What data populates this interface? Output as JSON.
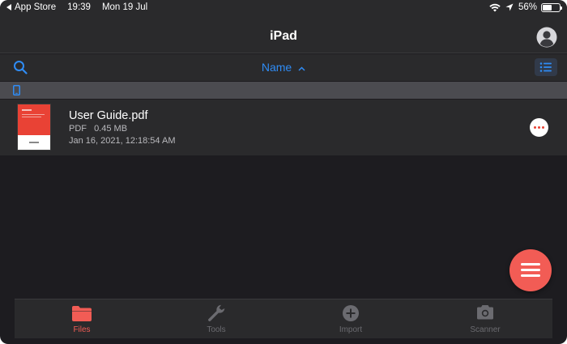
{
  "status_bar": {
    "back_app": "App Store",
    "time": "19:39",
    "date": "Mon 19 Jul",
    "battery": "56%",
    "battery_level": 0.56
  },
  "nav": {
    "title": "iPad",
    "account_icon": "person-circle-icon"
  },
  "toolbar": {
    "search_icon": "search-icon",
    "sort_label": "Name",
    "sort_caret": "^",
    "view_icon": "list-view-icon"
  },
  "section": {
    "icon": "ipad-device-icon"
  },
  "files": [
    {
      "name": "User Guide.pdf",
      "type": "PDF",
      "size": "0.45 MB",
      "date": "Jan 16, 2021, 12:18:54 AM"
    }
  ],
  "tabs": [
    {
      "label": "Files",
      "icon": "folder-icon",
      "active": true
    },
    {
      "label": "Tools",
      "icon": "wrench-icon",
      "active": false
    },
    {
      "label": "Import",
      "icon": "plus-circle-icon",
      "active": false
    },
    {
      "label": "Scanner",
      "icon": "camera-icon",
      "active": false
    }
  ],
  "colors": {
    "background": "#1d1c20",
    "panel": "#2a2a2c",
    "accent_blue": "#2f8cf5",
    "accent_red": "#f25c55",
    "inactive_tab": "#6b6b70"
  }
}
